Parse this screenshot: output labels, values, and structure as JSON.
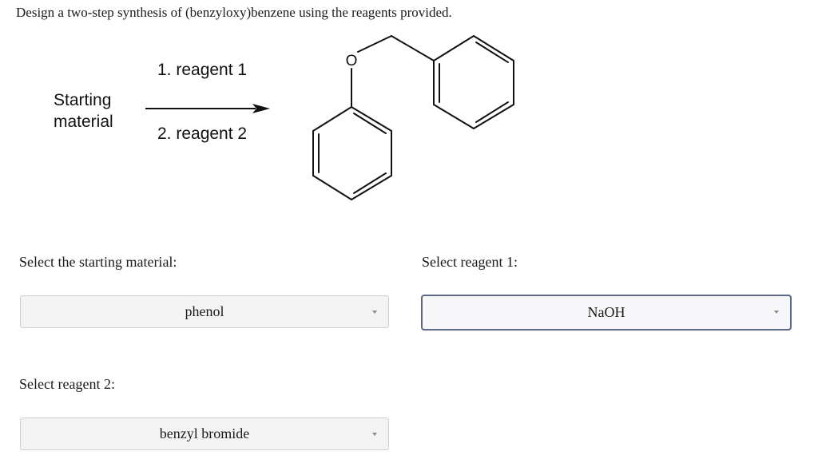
{
  "question": "Design a two-step synthesis of (benzyloxy)benzene using the reagents provided.",
  "scheme": {
    "starting_label_line1": "Starting",
    "starting_label_line2": "material",
    "step1": "1. reagent 1",
    "step2": "2. reagent 2",
    "oxygen_atom": "O"
  },
  "fields": {
    "starting_material": {
      "label": "Select the starting material:",
      "value": "phenol"
    },
    "reagent1": {
      "label": "Select reagent 1:",
      "value": "NaOH"
    },
    "reagent2": {
      "label": "Select reagent 2:",
      "value": "benzyl bromide"
    }
  },
  "icons": {
    "dropdown": "chevron-down-icon",
    "arrow": "reaction-arrow-icon"
  },
  "colors": {
    "focus_border": "#5a6a86",
    "select_bg": "#f3f3f3"
  }
}
